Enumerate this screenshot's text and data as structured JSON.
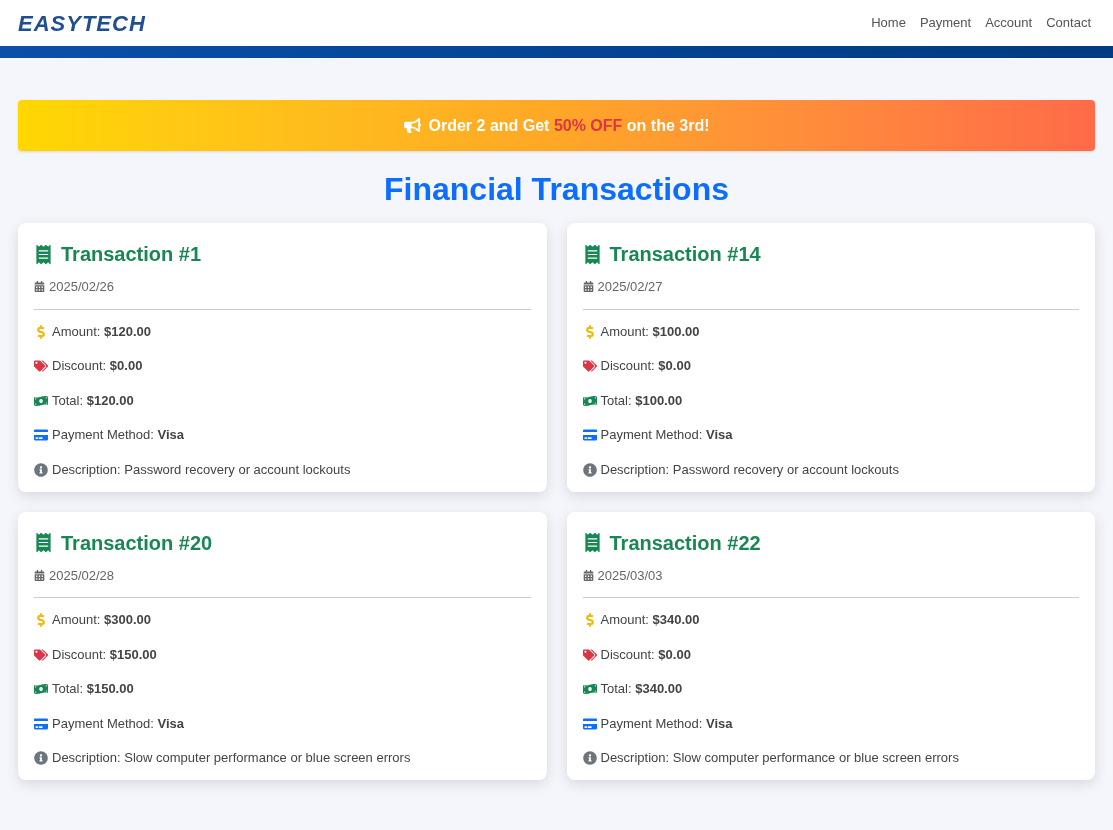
{
  "logo": "EASYTECH",
  "nav": [
    {
      "label": "Home"
    },
    {
      "label": "Payment"
    },
    {
      "label": "Account"
    },
    {
      "label": "Contact"
    }
  ],
  "banner": {
    "before": "Order 2 and Get",
    "highlight": "50% OFF",
    "after": "on the 3rd!"
  },
  "heading": "Financial Transactions",
  "transactions": [
    {
      "title": "Transaction #1",
      "date": "2025/02/26",
      "fields": [
        {
          "kind": "amount",
          "label": "Amount:",
          "value": "$120.00"
        },
        {
          "kind": "discount",
          "label": "Discount:",
          "value": "$0.00"
        },
        {
          "kind": "total",
          "label": "Total:",
          "value": "$120.00"
        },
        {
          "kind": "payment",
          "label": "Payment Method:",
          "value": "Visa"
        },
        {
          "kind": "description",
          "label": "Description:",
          "value": "Password recovery or account lockouts"
        }
      ]
    },
    {
      "title": "Transaction #14",
      "date": "2025/02/27",
      "fields": [
        {
          "kind": "amount",
          "label": "Amount:",
          "value": "$100.00"
        },
        {
          "kind": "discount",
          "label": "Discount:",
          "value": "$0.00"
        },
        {
          "kind": "total",
          "label": "Total:",
          "value": "$100.00"
        },
        {
          "kind": "payment",
          "label": "Payment Method:",
          "value": "Visa"
        },
        {
          "kind": "description",
          "label": "Description:",
          "value": "Password recovery or account lockouts"
        }
      ]
    },
    {
      "title": "Transaction #20",
      "date": "2025/02/28",
      "fields": [
        {
          "kind": "amount",
          "label": "Amount:",
          "value": "$300.00"
        },
        {
          "kind": "discount",
          "label": "Discount:",
          "value": "$150.00"
        },
        {
          "kind": "total",
          "label": "Total:",
          "value": "$150.00"
        },
        {
          "kind": "payment",
          "label": "Payment Method:",
          "value": "Visa"
        },
        {
          "kind": "description",
          "label": "Description:",
          "value": "Slow computer performance or blue screen errors"
        }
      ]
    },
    {
      "title": "Transaction #22",
      "date": "2025/03/03",
      "fields": [
        {
          "kind": "amount",
          "label": "Amount:",
          "value": "$340.00"
        },
        {
          "kind": "discount",
          "label": "Discount:",
          "value": "$0.00"
        },
        {
          "kind": "total",
          "label": "Total:",
          "value": "$340.00"
        },
        {
          "kind": "payment",
          "label": "Payment Method:",
          "value": "Visa"
        },
        {
          "kind": "description",
          "label": "Description:",
          "value": "Slow computer performance or blue screen errors"
        }
      ]
    }
  ]
}
